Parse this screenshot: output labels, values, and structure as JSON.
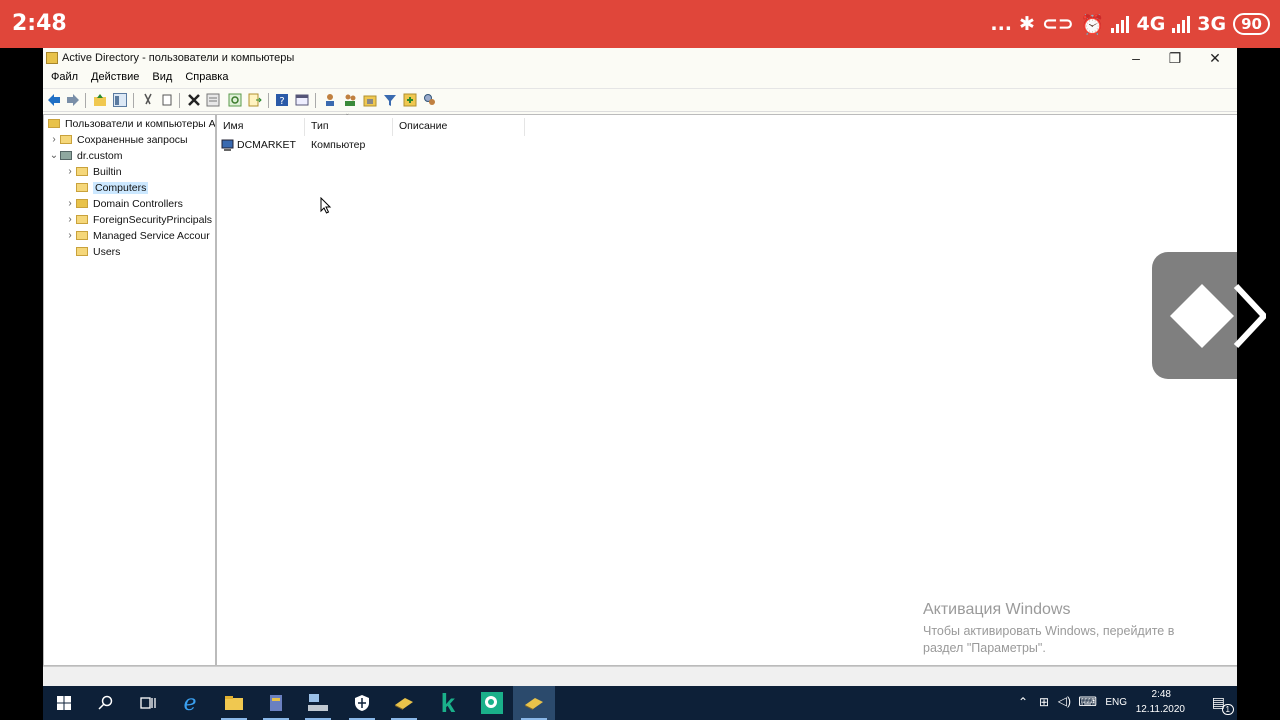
{
  "status_bar": {
    "time": "2:48",
    "overflow": "...",
    "network_4g": "4G",
    "network_3g": "3G",
    "battery": "90"
  },
  "window": {
    "title": "Active Directory - пользователи и компьютеры",
    "menu": [
      "Файл",
      "Действие",
      "Вид",
      "Справка"
    ]
  },
  "tree": {
    "root": "Пользователи и компьютеры A",
    "saved_queries": "Сохраненные запросы",
    "domain": "dr.custom",
    "children": [
      "Builtin",
      "Computers",
      "Domain Controllers",
      "ForeignSecurityPrincipals",
      "Managed Service Accour",
      "Users"
    ],
    "selected": "Computers"
  },
  "list": {
    "columns": [
      "Имя",
      "Тип",
      "Описание"
    ],
    "rows": [
      {
        "name": "DCMARKET",
        "type": "Компьютер",
        "description": ""
      }
    ]
  },
  "watermark": {
    "title": "Активация Windows",
    "text": "Чтобы активировать Windows, перейдите в раздел \"Параметры\"."
  },
  "taskbar": {
    "lang": "ENG",
    "time": "2:48",
    "date": "12.11.2020",
    "notification_count": "1"
  },
  "colors": {
    "status_bar": "#e0463a",
    "taskbar": "#0d2038",
    "selection": "#cce8ff"
  }
}
